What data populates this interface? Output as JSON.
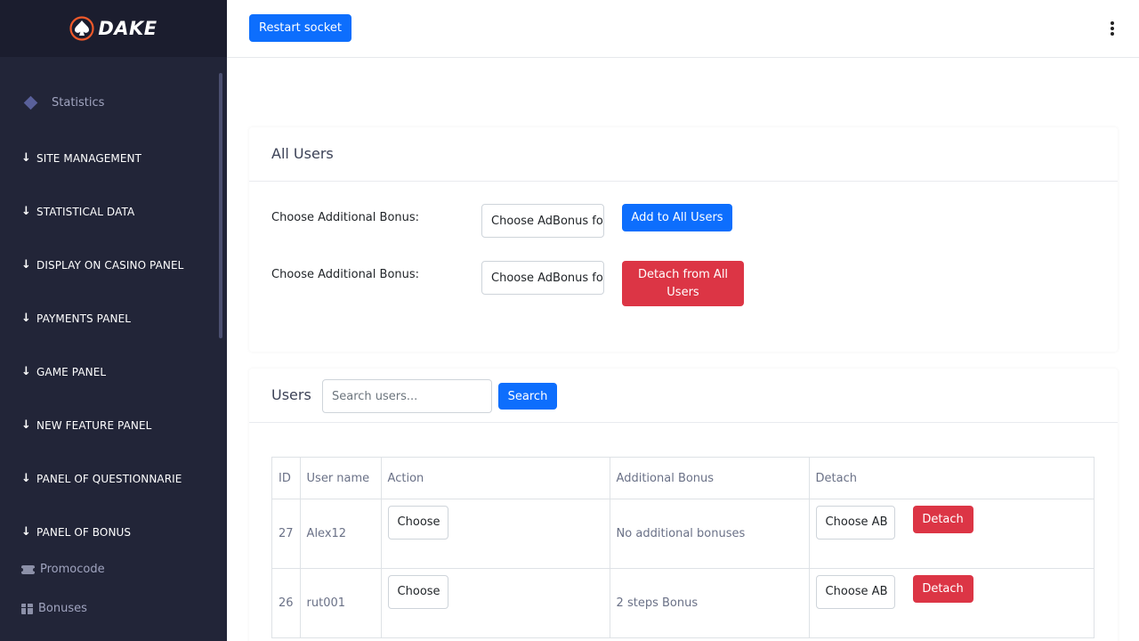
{
  "app": {
    "logo_text": "DAKE"
  },
  "sidebar": {
    "statistics_label": "Statistics",
    "sections": [
      "SITE MANAGEMENT",
      "STATISTICAL DATA",
      "DISPLAY ON CASINO PANEL",
      "PAYMENTS PANEL",
      "GAME PANEL",
      "NEW FEATURE PANEL",
      "PANEL OF QUESTIONNARIE",
      "PANEL OF BONUS"
    ],
    "sub_items": [
      {
        "label": "Promocode",
        "icon": "ticket-icon"
      },
      {
        "label": "Bonuses",
        "icon": "gift-icon"
      }
    ]
  },
  "topbar": {
    "restart_label": "Restart socket",
    "menu_icon": "kebab-menu-icon"
  },
  "all_users": {
    "title": "All Users",
    "rows": [
      {
        "label": "Choose Additional Bonus:",
        "select_value": "Choose AdBonus for",
        "button": "Add to All Users"
      },
      {
        "label": "Choose Additional Bonus:",
        "select_value": "Choose AdBonus for",
        "button": "Detach from All Users"
      }
    ]
  },
  "users": {
    "title": "Users",
    "search_placeholder": "Search users...",
    "search_label": "Search",
    "columns": [
      "ID",
      "User name",
      "Action",
      "Additional Bonus",
      "Detach"
    ],
    "rows": [
      {
        "id": "27",
        "name": "Alex12",
        "action_select": "Choose",
        "bonus": "No additional bonuses",
        "detach_select": "Choose AB",
        "detach_label": "Detach"
      },
      {
        "id": "26",
        "name": "rut001",
        "action_select": "Choose",
        "bonus": "2 steps Bonus",
        "detach_select": "Choose AB",
        "detach_label": "Detach"
      }
    ]
  },
  "colors": {
    "sidebar_bg": "#222538",
    "primary": "#0d6efd",
    "danger": "#dc3545",
    "logo_accent": "#f0592a"
  }
}
